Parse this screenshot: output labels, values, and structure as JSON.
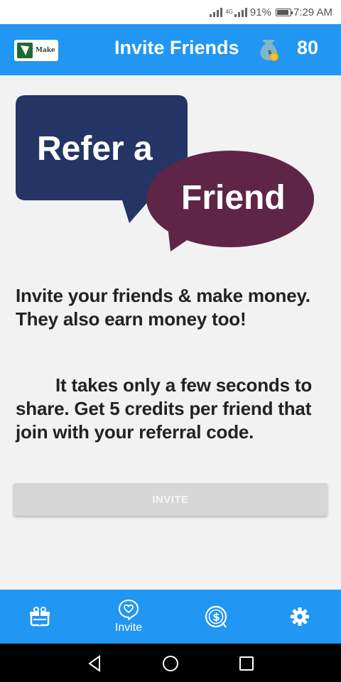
{
  "status_bar": {
    "network": "4G",
    "battery": "91%",
    "time": "7:29 AM"
  },
  "app_bar": {
    "logo_text": "Make",
    "title": "Invite Friends",
    "credits": "80",
    "coin_icon": "money-bag-icon"
  },
  "banner": {
    "line1": "Refer a",
    "line2": "Friend",
    "colors": {
      "left_bubble": "#243465",
      "right_bubble": "#5e2547"
    }
  },
  "content": {
    "paragraph1": "Invite your friends & make money. They also earn money too!",
    "paragraph2": "It takes only a few seconds to share. Get 5 credits per friend that join with your referral code.",
    "invite_button": "INVITE"
  },
  "bottom_nav": {
    "items": [
      {
        "icon": "gift-icon",
        "label": ""
      },
      {
        "icon": "invite-heart-icon",
        "label": "Invite"
      },
      {
        "icon": "dollar-coin-icon",
        "label": ""
      },
      {
        "icon": "gear-icon",
        "label": ""
      }
    ]
  },
  "colors": {
    "primary": "#2196f3",
    "button_disabled": "#d6d6d6"
  }
}
